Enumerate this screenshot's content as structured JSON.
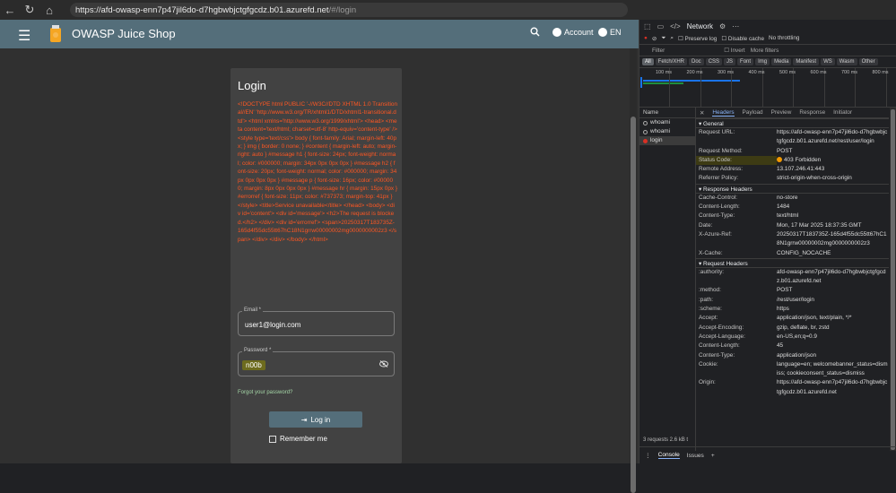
{
  "browser": {
    "url_host": "https://afd-owasp-enn7p47jil6do-d7hgbwbjctgfgcdz.b01.azurefd.net",
    "url_path": "/#/login"
  },
  "app": {
    "title": "OWASP Juice Shop",
    "account_label": "Account",
    "language_label": "EN",
    "toolbar_color": "#546e7a"
  },
  "login": {
    "title": "Login",
    "error_html": "<!DOCTYPE html PUBLIC '-//W3C//DTD XHTML 1.0 Transitional//EN' 'http://www.w3.org/TR/xhtml1/DTD/xhtml1-transitional.dtd'> <html xmlns='http://www.w3.org/1999/xhtml'> <head> <meta content='text/html; charset=utf-8' http-equiv='content-type' /> <style type='text/css'> body { font-family: Arial; margin-left: 40px; } img { border: 0 none; } #content { margin-left: auto; margin-right: auto } #message h1 { font-size: 24px; font-weight: normal; color: #000000; margin: 34px 0px 0px 0px } #message h2 { font-size: 20px; font-weight: normal; color: #000000; margin: 34px 0px 0px 0px } #message p { font-size: 16px; color: #000000; margin: 8px 0px 0px 0px } #message hr { margin: 15px 0px } #errorref { font-size: 11px; color: #737373; margin-top: 41px } </style> <title>Service unavailable</title> </head> <body> <div id='content'> <div id='message'> <h2>The request is blocked.</h2> </div> <div id='errorref'> <span>20250317T183735Z-165d4f55dc55tt67hC18N1grrw00000002mg0000000002z3 </span> </div> </div> </body> </html>",
    "email_label": "Email *",
    "email_value": "user1@login.com",
    "password_label": "Password *",
    "password_value": "n00b",
    "forgot_label": "Forgot your password?",
    "login_button": "Log in",
    "remember_label": "Remember me",
    "error_color": "#ff5722"
  },
  "devtools": {
    "active_tab": "Network",
    "preserve_log": "Preserve log",
    "disable_cache": "Disable cache",
    "throttling": "No throttling",
    "filter_placeholder": "Filter",
    "invert": "Invert",
    "more_filters": "More filters",
    "filter_chips": [
      "All",
      "Fetch/XHR",
      "Doc",
      "CSS",
      "JS",
      "Font",
      "Img",
      "Media",
      "Manifest",
      "WS",
      "Wasm",
      "Other"
    ],
    "timeline_labels": [
      "100 ms",
      "200 ms",
      "300 ms",
      "400 ms",
      "500 ms",
      "600 ms",
      "700 ms",
      "800 ms"
    ],
    "names_header": "Name",
    "requests": [
      {
        "name": "whoami",
        "selected": false
      },
      {
        "name": "whoami",
        "selected": false
      },
      {
        "name": "login",
        "selected": true
      }
    ],
    "detail_tabs": [
      "Headers",
      "Payload",
      "Preview",
      "Response",
      "Initiator"
    ],
    "general_title": "General",
    "general": [
      {
        "k": "Request URL:",
        "v": "https://afd-owasp-enn7p47jil6do-d7hgbwbjctgfgcdz.b01.azurefd.net/rest/user/login"
      },
      {
        "k": "Request Method:",
        "v": "POST"
      },
      {
        "k": "Status Code:",
        "v": "403 Forbidden"
      },
      {
        "k": "Remote Address:",
        "v": "13.107.246.41:443"
      },
      {
        "k": "Referrer Policy:",
        "v": "strict-origin-when-cross-origin"
      }
    ],
    "response_title": "Response Headers",
    "response": [
      {
        "k": "Cache-Control:",
        "v": "no-store"
      },
      {
        "k": "Content-Length:",
        "v": "1484"
      },
      {
        "k": "Content-Type:",
        "v": "text/html"
      },
      {
        "k": "Date:",
        "v": "Mon, 17 Mar 2025 18:37:35 GMT"
      },
      {
        "k": "X-Azure-Ref:",
        "v": "20250317T183735Z-165d4f55dc55tt67hC18N1grrw00000002mg0000000002z3"
      },
      {
        "k": "X-Cache:",
        "v": "CONFIG_NOCACHE"
      }
    ],
    "request_title": "Request Headers",
    "request": [
      {
        "k": ":authority:",
        "v": "afd-owasp-enn7p47jil6do-d7hgbwbjctgfgcdz.b01.azurefd.net"
      },
      {
        "k": ":method:",
        "v": "POST"
      },
      {
        "k": ":path:",
        "v": "/rest/user/login"
      },
      {
        "k": ":scheme:",
        "v": "https"
      },
      {
        "k": "Accept:",
        "v": "application/json, text/plain, */*"
      },
      {
        "k": "Accept-Encoding:",
        "v": "gzip, deflate, br, zstd"
      },
      {
        "k": "Accept-Language:",
        "v": "en-US,en;q=0.9"
      },
      {
        "k": "Content-Length:",
        "v": "45"
      },
      {
        "k": "Content-Type:",
        "v": "application/json"
      },
      {
        "k": "Cookie:",
        "v": "language=en; welcomebanner_status=dismiss; cookieconsent_status=dismiss"
      },
      {
        "k": "Origin:",
        "v": "https://afd-owasp-enn7p47jil6do-d7hgbwbjctgfgcdz.b01.azurefd.net"
      }
    ],
    "status_text": "3 requests 2.6 kB t",
    "drawer_tabs": [
      "Console",
      "Issues"
    ]
  }
}
